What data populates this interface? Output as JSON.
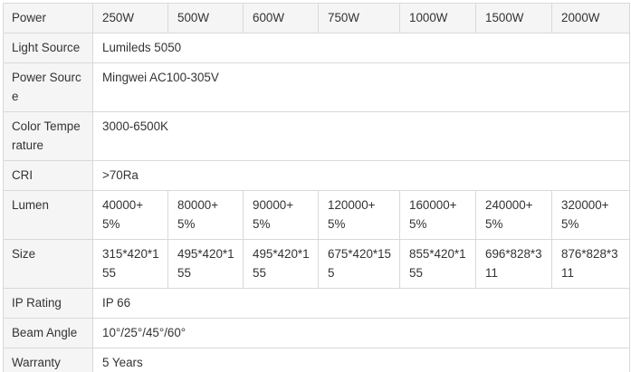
{
  "table": {
    "header": [
      "Power",
      "250W",
      "500W",
      "600W",
      "750W",
      "1000W",
      "1500W",
      "2000W"
    ],
    "light_source": {
      "label": "Light Source",
      "value": "Lumileds 5050"
    },
    "power_source": {
      "label": "Power Source",
      "value": "Mingwei AC100-305V"
    },
    "color_temperature": {
      "label": "Color Temperature",
      "value": "3000-6500K"
    },
    "cri": {
      "label": "CRI",
      "value": ">70Ra"
    },
    "lumen": {
      "label": "Lumen",
      "values": [
        "40000+5%",
        "80000+5%",
        "90000+5%",
        "120000+5%",
        "160000+5%",
        "240000+5%",
        "320000+5%"
      ]
    },
    "size": {
      "label": "Size",
      "values": [
        "315*420*155",
        "495*420*155",
        "495*420*155",
        "675*420*155",
        "855*420*155",
        "696*828*311",
        "876*828*311"
      ]
    },
    "ip_rating": {
      "label": "IP Rating",
      "value": "IP 66"
    },
    "beam_angle": {
      "label": "Beam Angle",
      "value": "10°/25°/45°/60°"
    },
    "warranty": {
      "label": "Warranty",
      "value": "5 Years"
    }
  }
}
